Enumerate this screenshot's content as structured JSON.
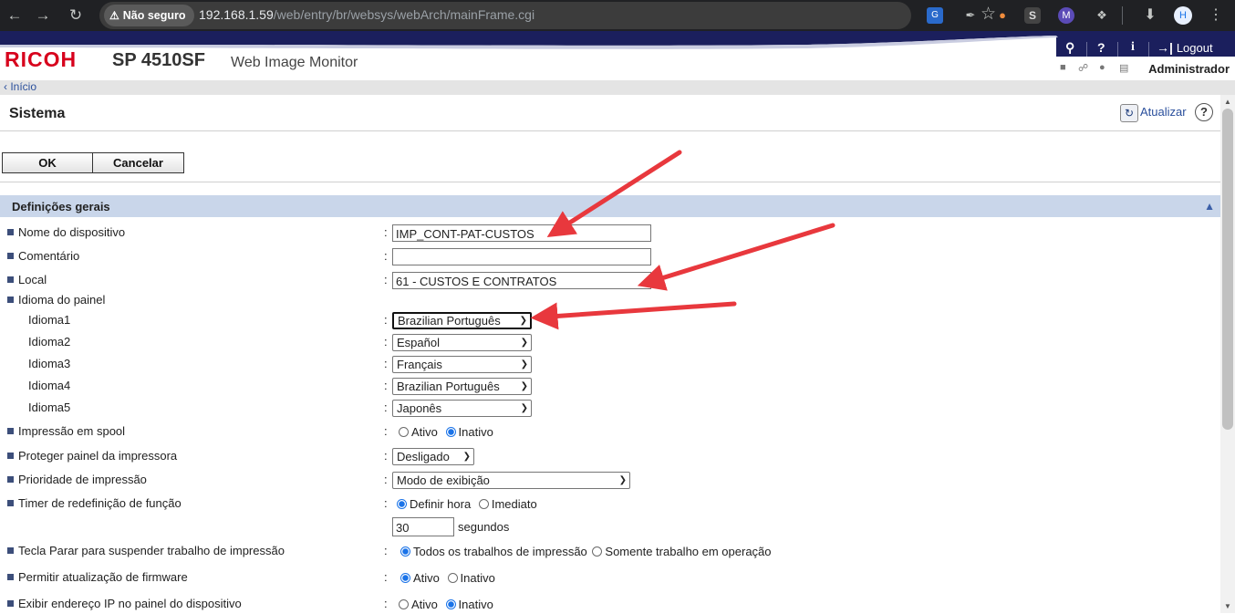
{
  "browser": {
    "security_label": "Não seguro",
    "url_host": "192.168.1.59",
    "url_path": "/web/entry/br/websys/webArch/mainFrame.cgi"
  },
  "header": {
    "logo": "RICOH",
    "model": "SP 4510SF",
    "app_name": "Web Image Monitor",
    "logout_label": "Logout",
    "user": "Administrador",
    "brand_color": "#d7001c",
    "toolbar_color": "#1b1f5d"
  },
  "breadcrumb": "Início",
  "page": {
    "title": "Sistema",
    "refresh_label": "Atualizar",
    "ok_label": "OK",
    "cancel_label": "Cancelar"
  },
  "section": {
    "title": "Definições gerais",
    "device_name": {
      "label": "Nome do dispositivo",
      "value": "IMP_CONT-PAT-CUSTOS"
    },
    "comment": {
      "label": "Comentário",
      "value": ""
    },
    "location": {
      "label": "Local",
      "value": "61 - CUSTOS E CONTRATOS"
    },
    "panel_language": {
      "label": "Idioma do painel",
      "items": [
        {
          "label": "Idioma1",
          "value": "Brazilian Português"
        },
        {
          "label": "Idioma2",
          "value": "Español"
        },
        {
          "label": "Idioma3",
          "value": "Français"
        },
        {
          "label": "Idioma4",
          "value": "Brazilian Português"
        },
        {
          "label": "Idioma5",
          "value": "Japonês"
        }
      ]
    },
    "spool": {
      "label": "Impressão em spool",
      "options": [
        "Ativo",
        "Inativo"
      ],
      "selected": "Inativo"
    },
    "protect_panel": {
      "label": "Proteger painel da impressora",
      "value": "Desligado"
    },
    "print_priority": {
      "label": "Prioridade de impressão",
      "value": "Modo de exibição"
    },
    "reset_timer": {
      "label": "Timer de redefinição de função",
      "options": [
        "Definir hora",
        "Imediato"
      ],
      "selected": "Definir hora",
      "seconds_value": "30",
      "seconds_unit": "segundos"
    },
    "stop_key": {
      "label": "Tecla Parar para suspender trabalho de impressão",
      "options": [
        "Todos os trabalhos de impressão",
        "Somente trabalho em operação"
      ],
      "selected": "Todos os trabalhos de impressão"
    },
    "firmware_update": {
      "label": "Permitir atualização de firmware",
      "options": [
        "Ativo",
        "Inativo"
      ],
      "selected": "Ativo"
    },
    "show_ip": {
      "label": "Exibir endereço IP no painel do dispositivo",
      "options": [
        "Ativo",
        "Inativo"
      ],
      "selected": "Inativo"
    }
  },
  "annotation_color": "#e8383d"
}
